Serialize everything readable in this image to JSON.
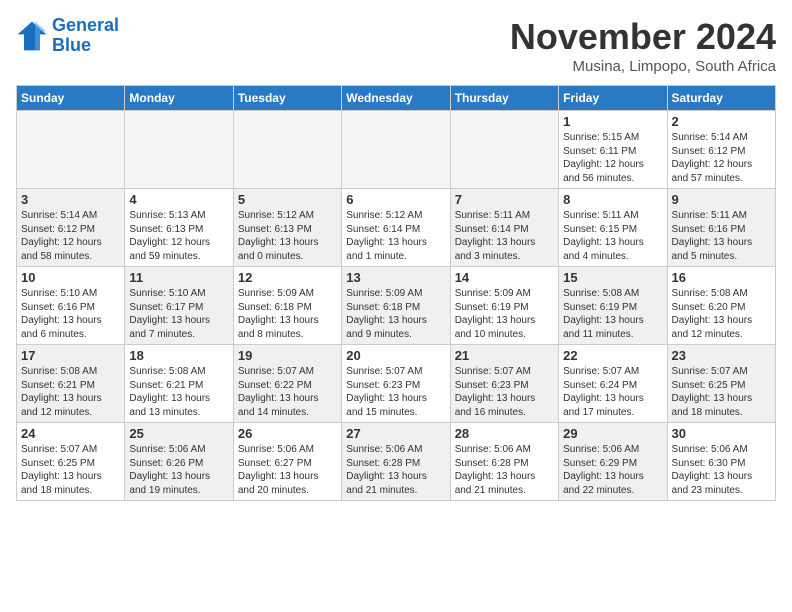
{
  "logo": {
    "line1": "General",
    "line2": "Blue"
  },
  "title": "November 2024",
  "subtitle": "Musina, Limpopo, South Africa",
  "days_of_week": [
    "Sunday",
    "Monday",
    "Tuesday",
    "Wednesday",
    "Thursday",
    "Friday",
    "Saturday"
  ],
  "weeks": [
    [
      {
        "day": "",
        "empty": true
      },
      {
        "day": "",
        "empty": true
      },
      {
        "day": "",
        "empty": true
      },
      {
        "day": "",
        "empty": true
      },
      {
        "day": "",
        "empty": true
      },
      {
        "day": "1",
        "info": "Sunrise: 5:15 AM\nSunset: 6:11 PM\nDaylight: 12 hours\nand 56 minutes."
      },
      {
        "day": "2",
        "info": "Sunrise: 5:14 AM\nSunset: 6:12 PM\nDaylight: 12 hours\nand 57 minutes."
      }
    ],
    [
      {
        "day": "3",
        "info": "Sunrise: 5:14 AM\nSunset: 6:12 PM\nDaylight: 12 hours\nand 58 minutes.",
        "shaded": true
      },
      {
        "day": "4",
        "info": "Sunrise: 5:13 AM\nSunset: 6:13 PM\nDaylight: 12 hours\nand 59 minutes.",
        "shaded": false
      },
      {
        "day": "5",
        "info": "Sunrise: 5:12 AM\nSunset: 6:13 PM\nDaylight: 13 hours\nand 0 minutes.",
        "shaded": true
      },
      {
        "day": "6",
        "info": "Sunrise: 5:12 AM\nSunset: 6:14 PM\nDaylight: 13 hours\nand 1 minute.",
        "shaded": false
      },
      {
        "day": "7",
        "info": "Sunrise: 5:11 AM\nSunset: 6:14 PM\nDaylight: 13 hours\nand 3 minutes.",
        "shaded": true
      },
      {
        "day": "8",
        "info": "Sunrise: 5:11 AM\nSunset: 6:15 PM\nDaylight: 13 hours\nand 4 minutes.",
        "shaded": false
      },
      {
        "day": "9",
        "info": "Sunrise: 5:11 AM\nSunset: 6:16 PM\nDaylight: 13 hours\nand 5 minutes.",
        "shaded": true
      }
    ],
    [
      {
        "day": "10",
        "info": "Sunrise: 5:10 AM\nSunset: 6:16 PM\nDaylight: 13 hours\nand 6 minutes.",
        "shaded": false
      },
      {
        "day": "11",
        "info": "Sunrise: 5:10 AM\nSunset: 6:17 PM\nDaylight: 13 hours\nand 7 minutes.",
        "shaded": true
      },
      {
        "day": "12",
        "info": "Sunrise: 5:09 AM\nSunset: 6:18 PM\nDaylight: 13 hours\nand 8 minutes.",
        "shaded": false
      },
      {
        "day": "13",
        "info": "Sunrise: 5:09 AM\nSunset: 6:18 PM\nDaylight: 13 hours\nand 9 minutes.",
        "shaded": true
      },
      {
        "day": "14",
        "info": "Sunrise: 5:09 AM\nSunset: 6:19 PM\nDaylight: 13 hours\nand 10 minutes.",
        "shaded": false
      },
      {
        "day": "15",
        "info": "Sunrise: 5:08 AM\nSunset: 6:19 PM\nDaylight: 13 hours\nand 11 minutes.",
        "shaded": true
      },
      {
        "day": "16",
        "info": "Sunrise: 5:08 AM\nSunset: 6:20 PM\nDaylight: 13 hours\nand 12 minutes.",
        "shaded": false
      }
    ],
    [
      {
        "day": "17",
        "info": "Sunrise: 5:08 AM\nSunset: 6:21 PM\nDaylight: 13 hours\nand 12 minutes.",
        "shaded": true
      },
      {
        "day": "18",
        "info": "Sunrise: 5:08 AM\nSunset: 6:21 PM\nDaylight: 13 hours\nand 13 minutes.",
        "shaded": false
      },
      {
        "day": "19",
        "info": "Sunrise: 5:07 AM\nSunset: 6:22 PM\nDaylight: 13 hours\nand 14 minutes.",
        "shaded": true
      },
      {
        "day": "20",
        "info": "Sunrise: 5:07 AM\nSunset: 6:23 PM\nDaylight: 13 hours\nand 15 minutes.",
        "shaded": false
      },
      {
        "day": "21",
        "info": "Sunrise: 5:07 AM\nSunset: 6:23 PM\nDaylight: 13 hours\nand 16 minutes.",
        "shaded": true
      },
      {
        "day": "22",
        "info": "Sunrise: 5:07 AM\nSunset: 6:24 PM\nDaylight: 13 hours\nand 17 minutes.",
        "shaded": false
      },
      {
        "day": "23",
        "info": "Sunrise: 5:07 AM\nSunset: 6:25 PM\nDaylight: 13 hours\nand 18 minutes.",
        "shaded": true
      }
    ],
    [
      {
        "day": "24",
        "info": "Sunrise: 5:07 AM\nSunset: 6:25 PM\nDaylight: 13 hours\nand 18 minutes.",
        "shaded": false
      },
      {
        "day": "25",
        "info": "Sunrise: 5:06 AM\nSunset: 6:26 PM\nDaylight: 13 hours\nand 19 minutes.",
        "shaded": true
      },
      {
        "day": "26",
        "info": "Sunrise: 5:06 AM\nSunset: 6:27 PM\nDaylight: 13 hours\nand 20 minutes.",
        "shaded": false
      },
      {
        "day": "27",
        "info": "Sunrise: 5:06 AM\nSunset: 6:28 PM\nDaylight: 13 hours\nand 21 minutes.",
        "shaded": true
      },
      {
        "day": "28",
        "info": "Sunrise: 5:06 AM\nSunset: 6:28 PM\nDaylight: 13 hours\nand 21 minutes.",
        "shaded": false
      },
      {
        "day": "29",
        "info": "Sunrise: 5:06 AM\nSunset: 6:29 PM\nDaylight: 13 hours\nand 22 minutes.",
        "shaded": true
      },
      {
        "day": "30",
        "info": "Sunrise: 5:06 AM\nSunset: 6:30 PM\nDaylight: 13 hours\nand 23 minutes.",
        "shaded": false
      }
    ]
  ]
}
